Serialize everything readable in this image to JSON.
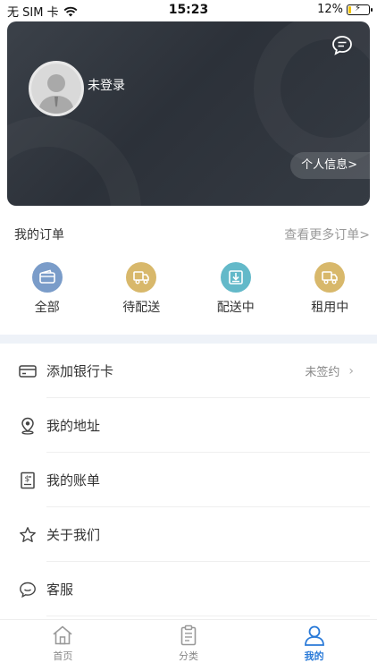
{
  "status_bar": {
    "carrier": "无 SIM 卡",
    "time": "15:23",
    "battery_percent": "12%",
    "battery_level": 0.12
  },
  "profile": {
    "username": "未登录",
    "info_button": "个人信息>"
  },
  "orders": {
    "title": "我的订单",
    "more": "查看更多订单>",
    "items": [
      {
        "label": "全部",
        "icon": "wallet-icon",
        "color": "#7a9cc9"
      },
      {
        "label": "待配送",
        "icon": "truck-icon",
        "color": "#d8b86b"
      },
      {
        "label": "配送中",
        "icon": "download-box-icon",
        "color": "#63b9c9"
      },
      {
        "label": "租用中",
        "icon": "truck-icon",
        "color": "#d8b86b"
      }
    ]
  },
  "menu": {
    "items": [
      {
        "label": "添加银行卡",
        "status": "未签约",
        "icon": "credit-card-icon"
      },
      {
        "label": "我的地址",
        "icon": "location-pin-icon"
      },
      {
        "label": "我的账单",
        "icon": "bill-icon"
      },
      {
        "label": "关于我们",
        "icon": "star-icon"
      },
      {
        "label": "客服",
        "icon": "chat-bubble-icon"
      }
    ]
  },
  "tabbar": {
    "tabs": [
      {
        "label": "首页",
        "icon": "home-icon",
        "active": false
      },
      {
        "label": "分类",
        "icon": "clipboard-icon",
        "active": false
      },
      {
        "label": "我的",
        "icon": "user-icon",
        "active": true
      }
    ],
    "active_color": "#2a7ad8"
  }
}
